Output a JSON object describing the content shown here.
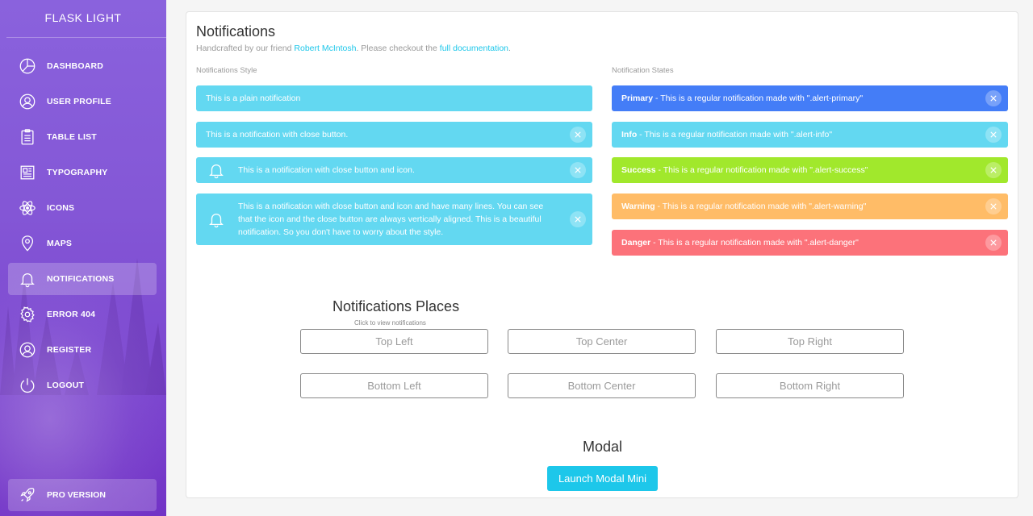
{
  "sidebar": {
    "brand": "FLASK LIGHT",
    "items": [
      {
        "label": "DASHBOARD",
        "icon": "pie-chart-icon"
      },
      {
        "label": "USER PROFILE",
        "icon": "user-icon"
      },
      {
        "label": "TABLE LIST",
        "icon": "clipboard-icon"
      },
      {
        "label": "TYPOGRAPHY",
        "icon": "news-icon"
      },
      {
        "label": "ICONS",
        "icon": "atom-icon"
      },
      {
        "label": "MAPS",
        "icon": "pin-icon"
      },
      {
        "label": "NOTIFICATIONS",
        "icon": "bell-icon",
        "active": true
      },
      {
        "label": "ERROR 404",
        "icon": "gear-icon"
      },
      {
        "label": "REGISTER",
        "icon": "user-icon"
      },
      {
        "label": "LOGOUT",
        "icon": "power-icon"
      }
    ],
    "pro": {
      "label": "PRO VERSION",
      "icon": "rocket-icon"
    }
  },
  "card": {
    "title": "Notifications",
    "subtitle_prefix": "Handcrafted by our friend ",
    "author": "Robert McIntosh",
    "subtitle_middle": ". Please checkout the ",
    "docs_link": "full documentation",
    "subtitle_suffix": "."
  },
  "styles": {
    "title": "Notifications Style",
    "items": [
      "This is a plain notification",
      "This is a notification with close button.",
      "This is a notification with close button and icon.",
      "This is a notification with close button and icon and have many lines. You can see that the icon and the close button are always vertically aligned. This is a beautiful notification. So you don't have to worry about the style."
    ]
  },
  "states": {
    "title": "Notification States",
    "items": [
      {
        "strong": "Primary",
        "text": " - This is a regular notification made with \".alert-primary\"",
        "color": "#447df7"
      },
      {
        "strong": "Info",
        "text": " - This is a regular notification made with \".alert-info\"",
        "color": "#63d8f1"
      },
      {
        "strong": "Success",
        "text": " - This is a regular notification made with \".alert-success\"",
        "color": "#a1e82c"
      },
      {
        "strong": "Warning",
        "text": " - This is a regular notification made with \".alert-warning\"",
        "color": "#ffbc67"
      },
      {
        "strong": "Danger",
        "text": " - This is a regular notification made with \".alert-danger\"",
        "color": "#fc727a"
      }
    ]
  },
  "places": {
    "title": "Notifications Places",
    "hint": "Click to view notifications",
    "buttons": [
      "Top Left",
      "Top Center",
      "Top Right",
      "Bottom Left",
      "Bottom Center",
      "Bottom Right"
    ]
  },
  "modal": {
    "title": "Modal",
    "button": "Launch Modal Mini"
  }
}
